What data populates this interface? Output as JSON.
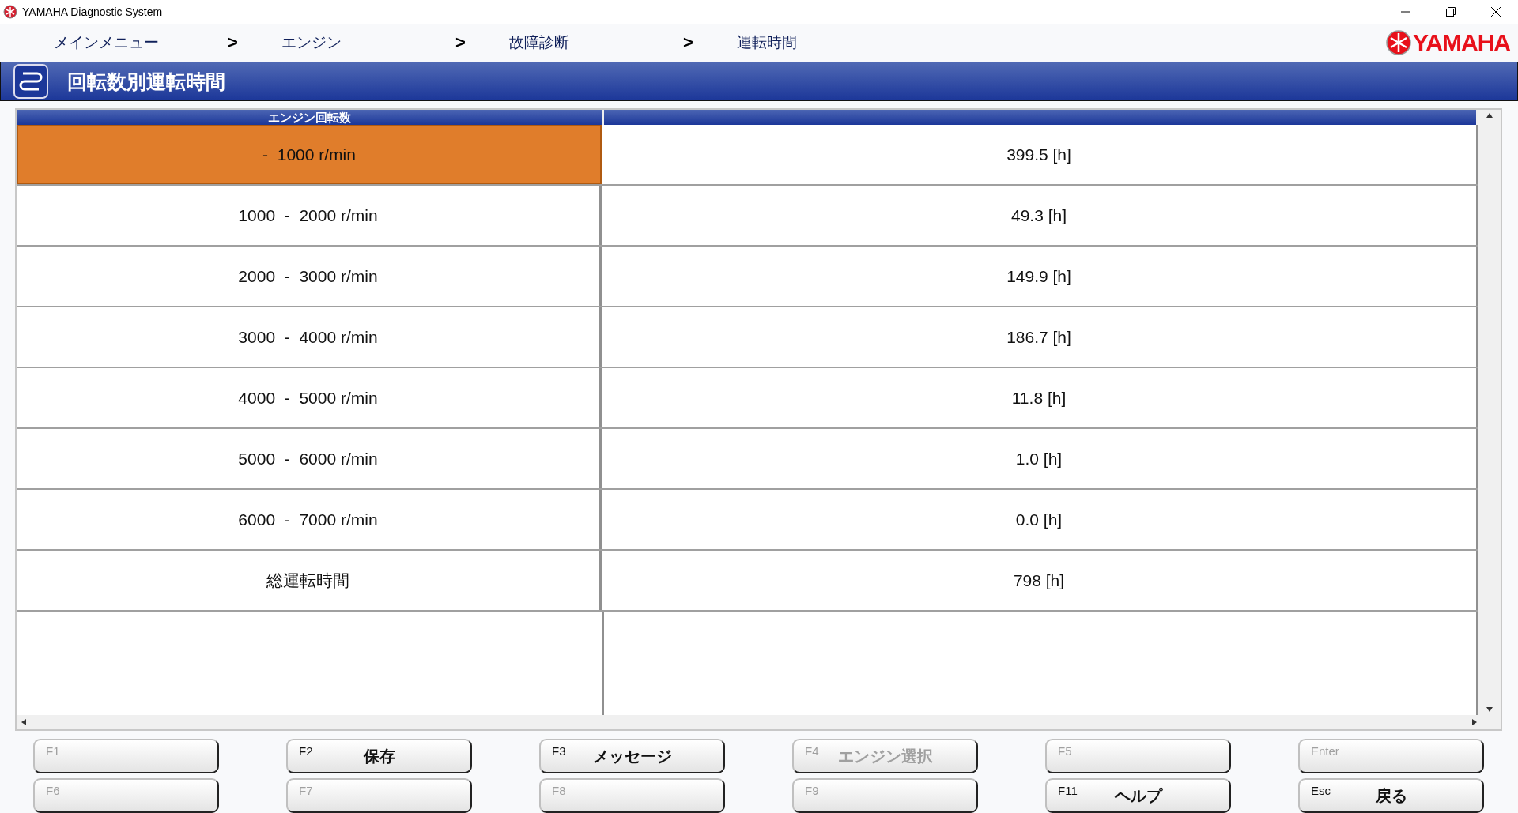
{
  "window": {
    "title": "YAMAHA Diagnostic System"
  },
  "breadcrumb": [
    "メインメニュー",
    "エンジン",
    "故障診断",
    "運転時間"
  ],
  "breadcrumb_separator": ">",
  "brand": "YAMAHA",
  "page_title": "回転数別運転時間",
  "table": {
    "columns": [
      "エンジン回転数",
      ""
    ],
    "rows": [
      {
        "range": "-  1000 r/min",
        "hours": "399.5 [h]",
        "selected": true
      },
      {
        "range": "1000  -  2000 r/min",
        "hours": "49.3 [h]",
        "selected": false
      },
      {
        "range": "2000  -  3000 r/min",
        "hours": "149.9 [h]",
        "selected": false
      },
      {
        "range": "3000  -  4000 r/min",
        "hours": "186.7 [h]",
        "selected": false
      },
      {
        "range": "4000  -  5000 r/min",
        "hours": "11.8 [h]",
        "selected": false
      },
      {
        "range": "5000  -  6000 r/min",
        "hours": "1.0 [h]",
        "selected": false
      },
      {
        "range": "6000  -  7000 r/min",
        "hours": "0.0 [h]",
        "selected": false
      },
      {
        "range": "総運転時間",
        "hours": "798 [h]",
        "selected": false
      }
    ]
  },
  "function_keys": [
    {
      "key": "F1",
      "disabled": true
    },
    {
      "key": "F2",
      "label": "保存",
      "disabled": false
    },
    {
      "key": "F3",
      "label": "メッセージ",
      "disabled": false
    },
    {
      "key": "F4",
      "label": "エンジン選択",
      "disabled": true
    },
    {
      "key": "F5",
      "disabled": true
    },
    {
      "key": "Enter",
      "disabled": true
    },
    {
      "key": "F6",
      "disabled": true
    },
    {
      "key": "F7",
      "disabled": true
    },
    {
      "key": "F8",
      "disabled": true
    },
    {
      "key": "F9",
      "disabled": true
    },
    {
      "key": "F11",
      "label": "ヘルプ",
      "disabled": false
    },
    {
      "key": "Esc",
      "label": "戻る",
      "disabled": false
    }
  ]
}
